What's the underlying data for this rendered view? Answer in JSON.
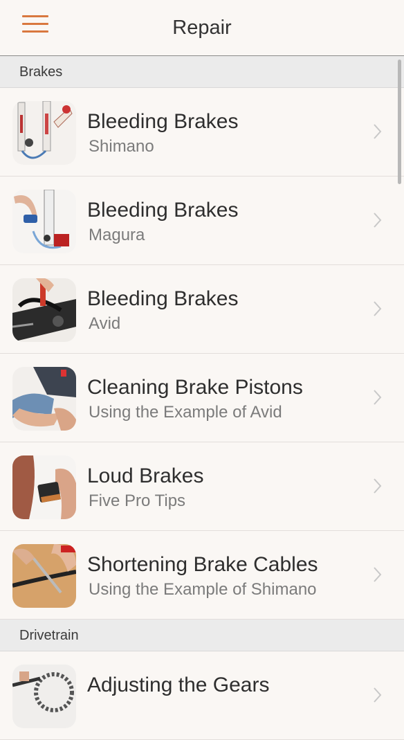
{
  "nav": {
    "title": "Repair",
    "menu_icon": "hamburger-icon",
    "accent_color": "#d9783f"
  },
  "sections": [
    {
      "title": "Brakes",
      "items": [
        {
          "title": "Bleeding Brakes",
          "subtitle": "Shimano",
          "thumbnail": "bleeding-shimano-thumbnail"
        },
        {
          "title": "Bleeding Brakes",
          "subtitle": "Magura",
          "thumbnail": "bleeding-magura-thumbnail"
        },
        {
          "title": "Bleeding Brakes",
          "subtitle": "Avid",
          "thumbnail": "bleeding-avid-thumbnail"
        },
        {
          "title": "Cleaning Brake Pistons",
          "subtitle": "Using the Example of Avid",
          "thumbnail": "cleaning-pistons-thumbnail"
        },
        {
          "title": "Loud Brakes",
          "subtitle": "Five Pro Tips",
          "thumbnail": "loud-brakes-thumbnail"
        },
        {
          "title": "Shortening Brake Cables",
          "subtitle": "Using the Example of Shimano",
          "thumbnail": "shortening-cables-thumbnail"
        }
      ]
    },
    {
      "title": "Drivetrain",
      "items": [
        {
          "title": "Adjusting the Gears",
          "subtitle": "",
          "thumbnail": "adjusting-gears-thumbnail"
        }
      ]
    }
  ]
}
